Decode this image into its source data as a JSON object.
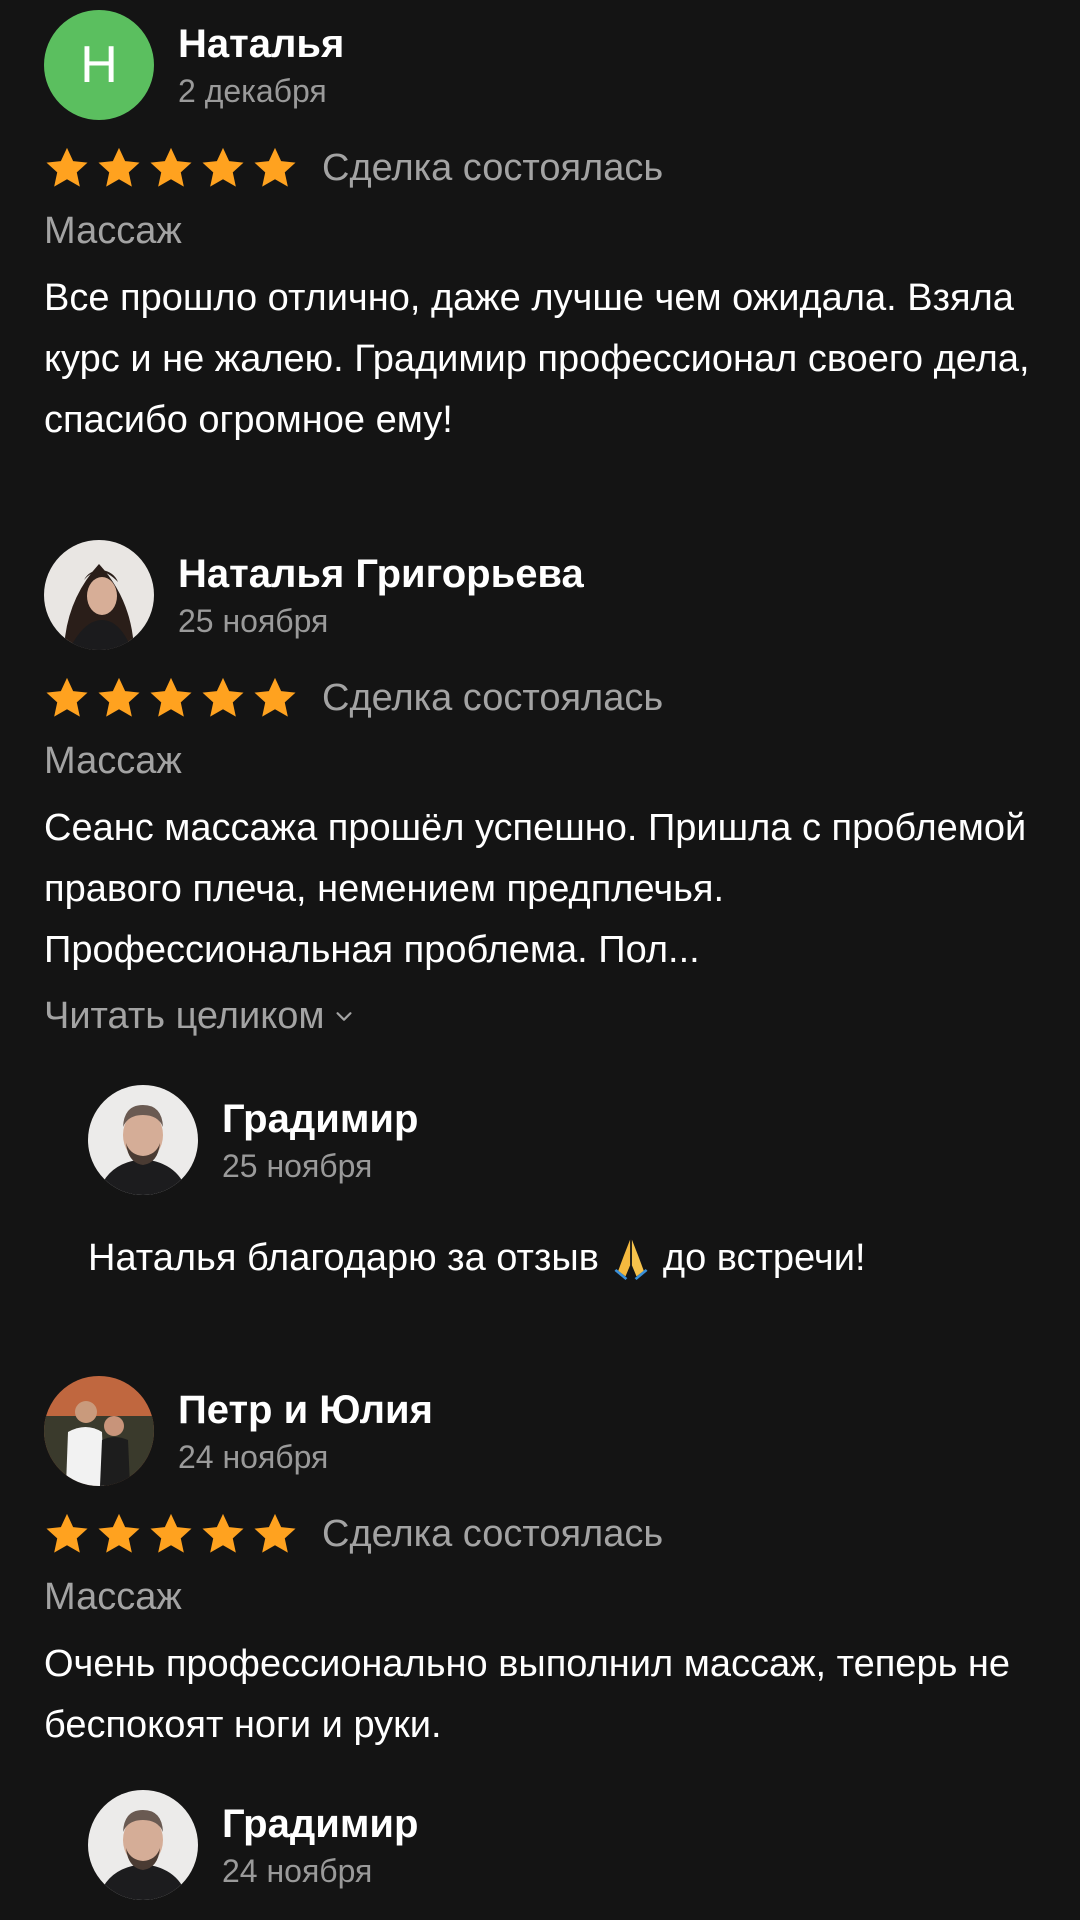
{
  "reviews": [
    {
      "author": "Наталья",
      "avatar_letter": "Н",
      "avatar_color": "#5bbf5f",
      "date": "2 декабря",
      "stars": 5,
      "status": "Сделка состоялась",
      "category": "Массаж",
      "text": "Все прошло отлично, даже лучше чем ожидала. Взяла курс и не жалею. Градимир профессионал своего дела, спасибо огромное ему!"
    },
    {
      "author": "Наталья Григорьева",
      "date": "25 ноября",
      "stars": 5,
      "status": "Сделка состоялась",
      "category": "Массаж",
      "text": "Сеанс массажа прошёл успешно. Пришла с проблемой правого плеча, немением предплечья. Профессиональная проблема. Пол...",
      "read_more": "Читать целиком",
      "reply": {
        "author": "Градимир",
        "date": "25 ноября",
        "text_before": "Наталья благодарю за отзыв",
        "emoji": "folded-hands",
        "text_after": "до встречи!"
      }
    },
    {
      "author": "Петр и Юлия",
      "date": "24 ноября",
      "stars": 5,
      "status": "Сделка состоялась",
      "category": "Массаж",
      "text": "Очень профессионально выполнил массаж, теперь не беспокоят ноги и руки.",
      "reply": {
        "author": "Градимир",
        "date": "24 ноября"
      }
    }
  ],
  "colors": {
    "background": "#141414",
    "star": "#ffa21f",
    "muted_text": "#a3a3a3"
  }
}
